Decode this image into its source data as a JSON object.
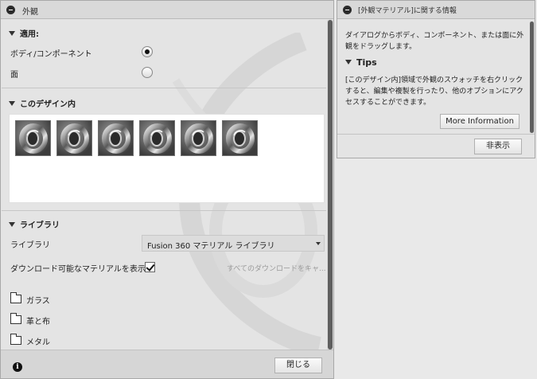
{
  "appearance_dialog": {
    "title": "外観",
    "apply_section": {
      "heading": "適用:",
      "options": [
        {
          "label": "ボディ/コンポーネント",
          "selected": true
        },
        {
          "label": "面",
          "selected": false
        }
      ]
    },
    "in_design_section": {
      "heading": "このデザイン内",
      "swatch_count": 6,
      "swatch_icon": "chrome-ring-material-icon"
    },
    "library_section": {
      "heading": "ライブラリ",
      "library_label": "ライブラリ",
      "library_value": "Fusion 360 マテリアル ライブラリ",
      "show_downloadable_label": "ダウンロード可能なマテリアルを表示",
      "show_downloadable_checked": true,
      "download_all_label": "すべてのダウンロードをキャ...",
      "folders": [
        "ガラス",
        "革と布",
        "メタル"
      ]
    },
    "close_button": "閉じる"
  },
  "info_panel": {
    "title": "[外観マテリアル]に関する情報",
    "description": "ダイアログからボディ、コンポーネント、または面に外観をドラッグします。",
    "tips_heading": "Tips",
    "tips_text": "[このデザイン内]領域で外観のスウォッチを右クリックすると、編集や複製を行ったり、他のオプションにアクセスすることができます。",
    "more_info_button": "More Information",
    "hide_button": "非表示"
  },
  "colors": {
    "panel_bg": "#e4e4e4",
    "titlebar_bg": "#d9d9d9",
    "scroll_thumb": "#5f5f5f"
  }
}
